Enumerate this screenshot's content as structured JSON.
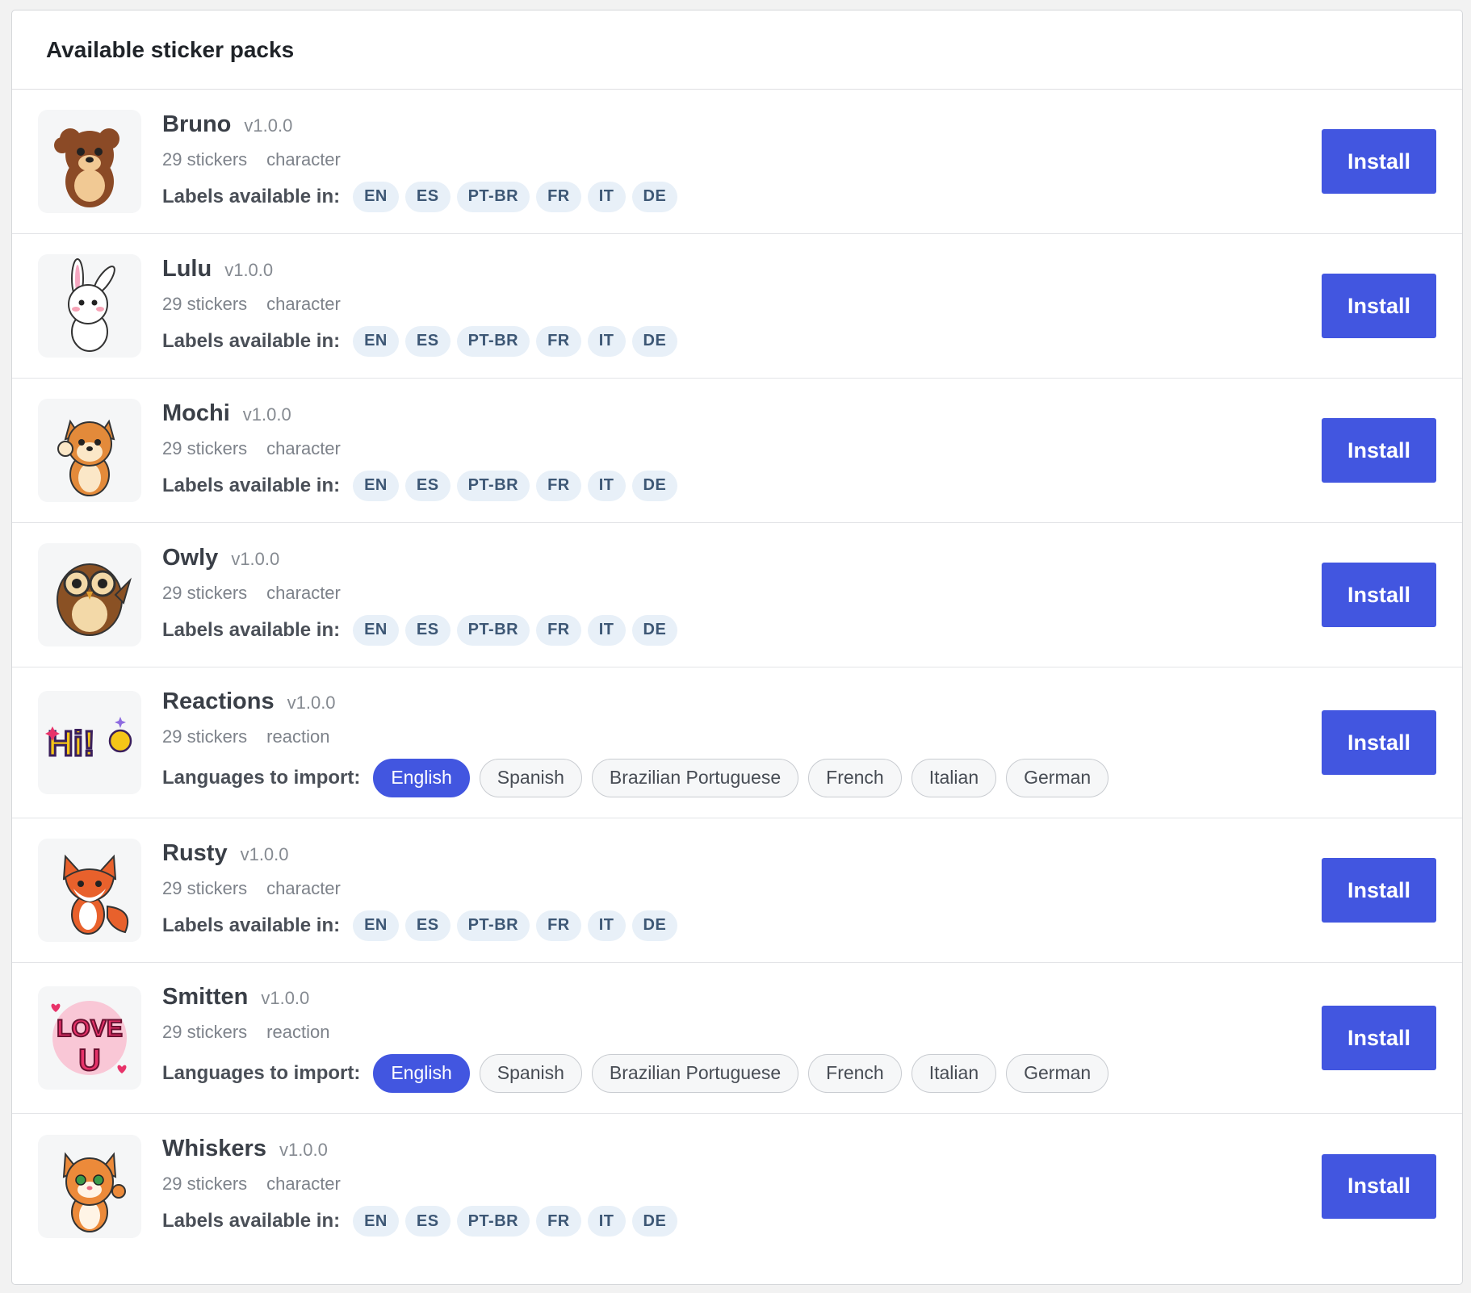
{
  "panel": {
    "title": "Available sticker packs"
  },
  "packs": [
    {
      "name": "Bruno",
      "version": "v1.0.0",
      "count": "29 stickers",
      "category": "character",
      "lang_label": "Labels available in:",
      "chips": [
        "EN",
        "ES",
        "PT-BR",
        "FR",
        "IT",
        "DE"
      ],
      "install_label": "Install",
      "icon": "bear-sticker-icon",
      "color": "#8b4a26"
    },
    {
      "name": "Lulu",
      "version": "v1.0.0",
      "count": "29 stickers",
      "category": "character",
      "lang_label": "Labels available in:",
      "chips": [
        "EN",
        "ES",
        "PT-BR",
        "FR",
        "IT",
        "DE"
      ],
      "install_label": "Install",
      "icon": "bunny-sticker-icon",
      "color": "#ffffff"
    },
    {
      "name": "Mochi",
      "version": "v1.0.0",
      "count": "29 stickers",
      "category": "character",
      "lang_label": "Labels available in:",
      "chips": [
        "EN",
        "ES",
        "PT-BR",
        "FR",
        "IT",
        "DE"
      ],
      "install_label": "Install",
      "icon": "shiba-sticker-icon",
      "color": "#e38a3a"
    },
    {
      "name": "Owly",
      "version": "v1.0.0",
      "count": "29 stickers",
      "category": "character",
      "lang_label": "Labels available in:",
      "chips": [
        "EN",
        "ES",
        "PT-BR",
        "FR",
        "IT",
        "DE"
      ],
      "install_label": "Install",
      "icon": "owl-sticker-icon",
      "color": "#8a5124"
    },
    {
      "name": "Reactions",
      "version": "v1.0.0",
      "count": "29 stickers",
      "category": "reaction",
      "lang_label": "Languages to import:",
      "languages": [
        "English",
        "Spanish",
        "Brazilian Portuguese",
        "French",
        "Italian",
        "German"
      ],
      "selected_language": "English",
      "install_label": "Install",
      "icon": "hi-wave-sticker-icon",
      "color": "#f5c518",
      "thumb_text": "Hi!"
    },
    {
      "name": "Rusty",
      "version": "v1.0.0",
      "count": "29 stickers",
      "category": "character",
      "lang_label": "Labels available in:",
      "chips": [
        "EN",
        "ES",
        "PT-BR",
        "FR",
        "IT",
        "DE"
      ],
      "install_label": "Install",
      "icon": "fox-sticker-icon",
      "color": "#e8612c"
    },
    {
      "name": "Smitten",
      "version": "v1.0.0",
      "count": "29 stickers",
      "category": "reaction",
      "lang_label": "Languages to import:",
      "languages": [
        "English",
        "Spanish",
        "Brazilian Portuguese",
        "French",
        "Italian",
        "German"
      ],
      "selected_language": "English",
      "install_label": "Install",
      "icon": "love-u-sticker-icon",
      "color": "#e8336a",
      "thumb_text": "LOVE U"
    },
    {
      "name": "Whiskers",
      "version": "v1.0.0",
      "count": "29 stickers",
      "category": "character",
      "lang_label": "Labels available in:",
      "chips": [
        "EN",
        "ES",
        "PT-BR",
        "FR",
        "IT",
        "DE"
      ],
      "install_label": "Install",
      "icon": "cat-sticker-icon",
      "color": "#ec8a3a"
    }
  ],
  "colors": {
    "accent": "#4256e0",
    "chip_bg": "#e8f0f8",
    "chip_text": "#3d5775"
  }
}
